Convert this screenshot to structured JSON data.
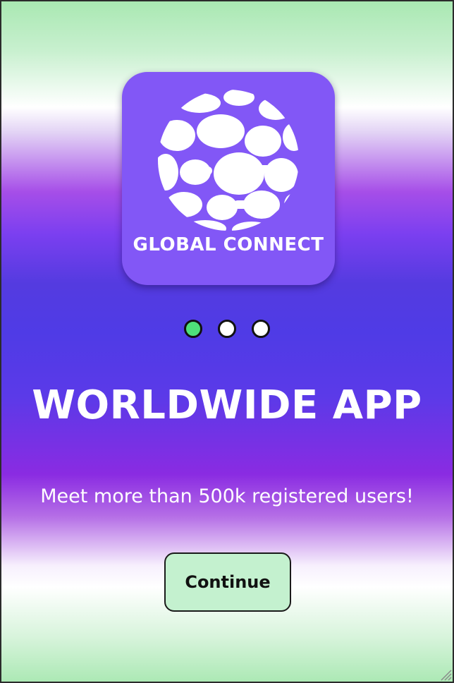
{
  "logo": {
    "text": "GLOBAL CONNECT",
    "icon": "globe-icon",
    "tile_color": "#8257f6"
  },
  "pagination": {
    "count": 3,
    "active_index": 0,
    "active_color": "#4ee07a",
    "inactive_color": "#ffffff"
  },
  "main": {
    "title": "WORLDWIDE APP",
    "subtitle": "Meet more than 500k registered users!",
    "continue_label": "Continue"
  },
  "colors": {
    "button_bg": "#c4f1cf",
    "text_light": "#ffffff"
  }
}
